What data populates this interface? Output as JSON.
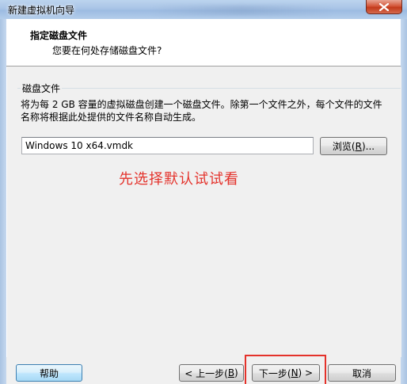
{
  "window": {
    "title": "新建虚拟机向导"
  },
  "header": {
    "title": "指定磁盘文件",
    "subtitle": "您要在何处存储磁盘文件?"
  },
  "disk_file": {
    "group_label": "磁盘文件",
    "description_line1": "将为每 2 GB 容量的虚拟磁盘创建一个磁盘文件。除第一个文件之外，每个文件的文件",
    "description_line2": "名称将根据此处提供的文件名称自动生成。",
    "file_name": "Windows 10 x64.vmdk",
    "browse_label_pre": "浏览(",
    "browse_key": "R",
    "browse_label_post": ")..."
  },
  "annotation": {
    "text": "先选择默认试试看",
    "color": "#e4322b"
  },
  "footer": {
    "help_label": "帮助",
    "back_label_pre": "< 上一步(",
    "back_key": "B",
    "back_label_post": ")",
    "next_label_pre": "下一步(",
    "next_key": "N",
    "next_label_post": ") >",
    "cancel_label": "取消"
  }
}
